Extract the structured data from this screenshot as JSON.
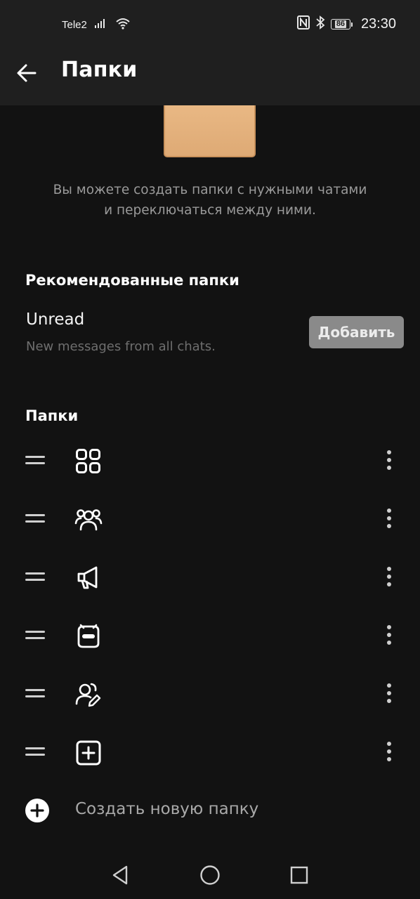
{
  "status_bar": {
    "carrier": "Tele2",
    "battery": "86",
    "time": "23:30",
    "icons": [
      "signal-icon",
      "wifi-icon",
      "nfc-icon",
      "bluetooth-icon",
      "battery-icon"
    ]
  },
  "header": {
    "title": "Папки",
    "back_icon": "arrow-left-icon"
  },
  "intro": {
    "line1": "Вы можете создать папки с нужными чатами",
    "line2": "и переключаться между ними."
  },
  "recommended": {
    "title": "Рекомендованные папки",
    "item": {
      "name": "Unread",
      "description": "New messages from all chats.",
      "button": "Добавить"
    }
  },
  "folders": {
    "title": "Папки",
    "items": [
      {
        "icon": "grid-icon"
      },
      {
        "icon": "group-icon"
      },
      {
        "icon": "megaphone-icon"
      },
      {
        "icon": "bot-icon"
      },
      {
        "icon": "user-edit-icon"
      },
      {
        "icon": "plus-square-icon"
      }
    ],
    "create_label": "Создать новую папку"
  },
  "colors": {
    "background": "#121212",
    "bar": "#1f1f1f",
    "folder_art": "#e5b47f",
    "button": "#8a8a8a"
  }
}
